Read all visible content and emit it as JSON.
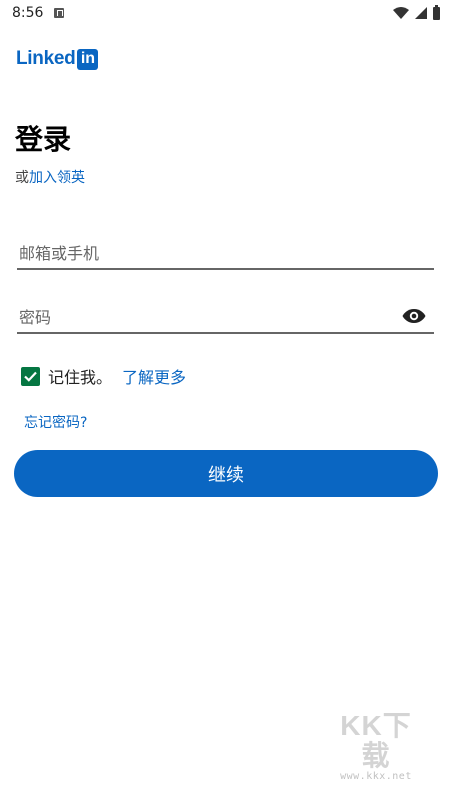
{
  "status_bar": {
    "time": "8:56",
    "icons": [
      "notification-icon",
      "wifi-icon",
      "signal-icon",
      "battery-icon"
    ]
  },
  "brand": {
    "logo_text": "Linked",
    "logo_box_text": "in",
    "color": "#0a66c2"
  },
  "login": {
    "title": "登录",
    "join_prefix": "或",
    "join_link": "加入领英",
    "email_placeholder": "邮箱或手机",
    "password_placeholder": "密码",
    "remember_label": "记住我。",
    "remember_checked": true,
    "learn_more": "了解更多",
    "forgot_password": "忘记密码?",
    "continue_label": "继续"
  },
  "watermark": {
    "logo": "KK下载",
    "url": "www.kkx.net"
  },
  "colors": {
    "accent": "#0a66c2",
    "checkbox": "#057642"
  }
}
